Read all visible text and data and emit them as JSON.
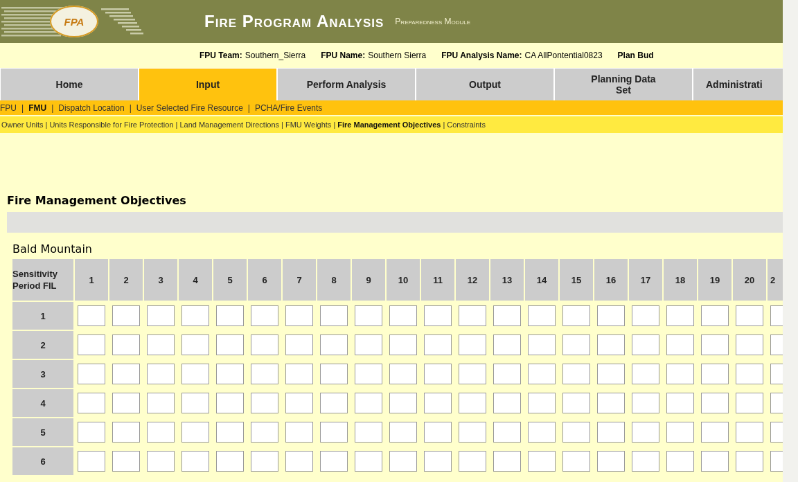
{
  "header": {
    "logo": "FPA",
    "title": "Fire Program Analysis",
    "subtitle": "Preparedness Module"
  },
  "info": [
    {
      "label": "FPU Team:",
      "value": "Southern_Sierra"
    },
    {
      "label": "FPU Name:",
      "value": "Southern Sierra"
    },
    {
      "label": "FPU Analysis Name:",
      "value": "CA AllPontential0823"
    },
    {
      "label": "Plan Bud"
    }
  ],
  "tabs": [
    {
      "label": "Home",
      "selected": false
    },
    {
      "label": "Input",
      "selected": true
    },
    {
      "label": "Perform Analysis",
      "selected": false
    },
    {
      "label": "Output",
      "selected": false
    },
    {
      "label": "Planning Data Set",
      "selected": false
    },
    {
      "label": "Administrati",
      "selected": false
    }
  ],
  "subnav": {
    "separator": "|",
    "items": [
      {
        "label": "FPU",
        "selected": false
      },
      {
        "label": "FMU",
        "selected": true
      },
      {
        "label": "Dispatch Location",
        "selected": false
      },
      {
        "label": "User Selected Fire Resource",
        "selected": false
      },
      {
        "label": "PCHA/Fire Events",
        "selected": false
      }
    ]
  },
  "subnav2": {
    "separator": "|",
    "items": [
      {
        "label": "Owner Units",
        "selected": false
      },
      {
        "label": "Units Responsible for Fire Protection",
        "selected": false
      },
      {
        "label": "Land Management Directions",
        "selected": false
      },
      {
        "label": "FMU Weights",
        "selected": false
      },
      {
        "label": "Fire Management Objectives",
        "selected": true
      },
      {
        "label": "Constraints",
        "selected": false
      }
    ]
  },
  "section_title": "Fire Management Objectives",
  "unit": "Bald Mountain",
  "table": {
    "corner": "Sensitivity Period FIL",
    "columns": [
      "1",
      "2",
      "3",
      "4",
      "5",
      "6",
      "7",
      "8",
      "9",
      "10",
      "11",
      "12",
      "13",
      "14",
      "15",
      "16",
      "17",
      "18",
      "19",
      "20",
      "2"
    ],
    "rows": [
      "1",
      "2",
      "3",
      "4",
      "5",
      "6"
    ]
  }
}
